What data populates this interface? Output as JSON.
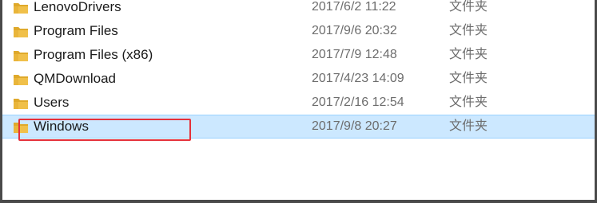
{
  "files": [
    {
      "name": "LenovoDrivers",
      "date": "2017/6/2 11:22",
      "type": "文件夹",
      "selected": false
    },
    {
      "name": "Program Files",
      "date": "2017/9/6 20:32",
      "type": "文件夹",
      "selected": false
    },
    {
      "name": "Program Files (x86)",
      "date": "2017/7/9 12:48",
      "type": "文件夹",
      "selected": false
    },
    {
      "name": "QMDownload",
      "date": "2017/4/23 14:09",
      "type": "文件夹",
      "selected": false
    },
    {
      "name": "Users",
      "date": "2017/2/16 12:54",
      "type": "文件夹",
      "selected": false
    },
    {
      "name": "Windows",
      "date": "2017/9/8 20:27",
      "type": "文件夹",
      "selected": true
    }
  ],
  "colors": {
    "selection_bg": "#cce8ff",
    "highlight_border": "#e5303a",
    "folder_yellow": "#f0c04a"
  },
  "icons": {
    "folder": "folder-icon"
  }
}
